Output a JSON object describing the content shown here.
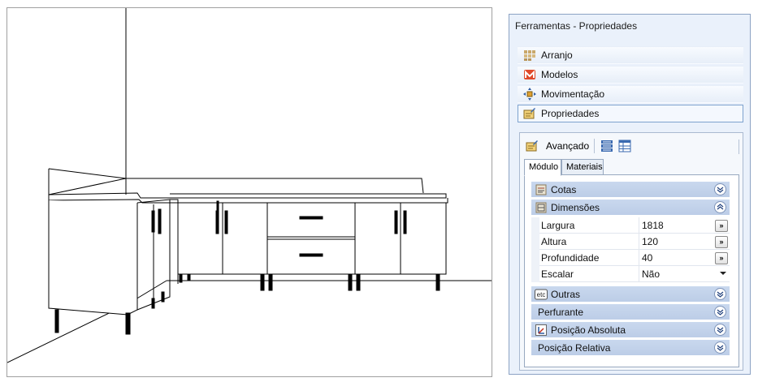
{
  "panel": {
    "title": "Ferramentas - Propriedades",
    "tools": [
      {
        "label": "Arranjo",
        "icon": "arrange-icon"
      },
      {
        "label": "Modelos",
        "icon": "models-icon"
      },
      {
        "label": "Movimentação",
        "icon": "move-icon"
      },
      {
        "label": "Propriedades",
        "icon": "properties-icon",
        "selected": true
      }
    ],
    "advanced": {
      "label": "Avançado"
    },
    "tabs": [
      {
        "label": "Módulo",
        "active": true
      },
      {
        "label": "Materiais",
        "active": false
      }
    ],
    "groups": {
      "cotas": "Cotas",
      "dimensoes": "Dimensões",
      "outras": "Outras",
      "perfurante": "Perfurante",
      "posicao_absoluta": "Posição Absoluta",
      "posicao_relativa": "Posição Relativa"
    },
    "properties": [
      {
        "name": "Largura",
        "value": "1818",
        "button": "»"
      },
      {
        "name": "Altura",
        "value": "120",
        "button": "»"
      },
      {
        "name": "Profundidade",
        "value": "40",
        "button": "»"
      },
      {
        "name": "Escalar",
        "value": "Não"
      }
    ],
    "colors": {
      "group_header": "#c9d8ee",
      "selection_border": "#7da2ce",
      "panel_bg": "#eaf1fb"
    }
  }
}
